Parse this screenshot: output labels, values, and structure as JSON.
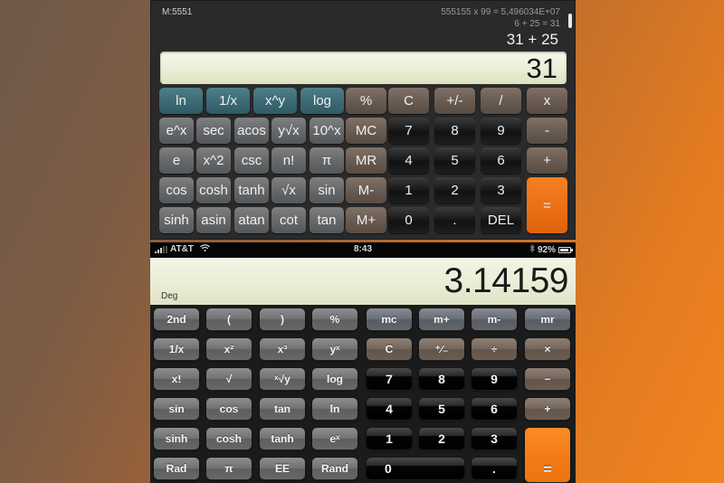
{
  "top_calculator": {
    "memory_label": "M:5551",
    "history": [
      "555155 x 99 = 5,496034E+07",
      "6 + 25 = 31"
    ],
    "current_expression": "31 + 25",
    "display_value": "31",
    "keys": [
      {
        "label": "ln",
        "style": "teal",
        "row": 0,
        "col": 0,
        "name": "key-ln"
      },
      {
        "label": "1/x",
        "style": "teal",
        "row": 0,
        "col": 1,
        "name": "key-reciprocal"
      },
      {
        "label": "x^y",
        "style": "teal",
        "row": 0,
        "col": 2,
        "name": "key-power"
      },
      {
        "label": "log",
        "style": "teal",
        "row": 0,
        "col": 3,
        "name": "key-log"
      },
      {
        "label": "%",
        "style": "brown",
        "row": 0,
        "col": 4,
        "name": "key-percent"
      },
      {
        "label": "C",
        "style": "brown",
        "row": 0,
        "col": 5,
        "name": "key-clear"
      },
      {
        "label": "+/-",
        "style": "brown",
        "row": 0,
        "col": 6,
        "name": "key-sign"
      },
      {
        "label": "/",
        "style": "brown",
        "row": 0,
        "col": 7,
        "name": "key-divide"
      },
      {
        "label": "x",
        "style": "brown",
        "row": 0,
        "col": 8,
        "name": "key-multiply"
      },
      {
        "label": "e^x",
        "style": "grey",
        "row": 1,
        "col": 0,
        "name": "key-exp"
      },
      {
        "label": "sec",
        "style": "grey",
        "row": 1,
        "col": 1,
        "name": "key-sec"
      },
      {
        "label": "acos",
        "style": "grey",
        "row": 1,
        "col": 2,
        "name": "key-acos"
      },
      {
        "label": "y√x",
        "style": "grey",
        "row": 1,
        "col": 3,
        "name": "key-yroot"
      },
      {
        "label": "10^x",
        "style": "grey",
        "row": 1,
        "col": 4,
        "name": "key-ten-power"
      },
      {
        "label": "MC",
        "style": "brown",
        "row": 1,
        "col": 5,
        "name": "key-mc"
      },
      {
        "label": "7",
        "style": "black",
        "row": 1,
        "col": 6,
        "name": "key-7"
      },
      {
        "label": "8",
        "style": "black",
        "row": 1,
        "col": 7,
        "name": "key-8"
      },
      {
        "label": "9",
        "style": "black",
        "row": 1,
        "col": 8,
        "name": "key-9"
      },
      {
        "label": "-",
        "style": "brown",
        "row": 1,
        "col": 9,
        "name": "key-minus"
      },
      {
        "label": "e",
        "style": "grey",
        "row": 2,
        "col": 0,
        "name": "key-e"
      },
      {
        "label": "x^2",
        "style": "grey",
        "row": 2,
        "col": 1,
        "name": "key-square"
      },
      {
        "label": "csc",
        "style": "grey",
        "row": 2,
        "col": 2,
        "name": "key-csc"
      },
      {
        "label": "n!",
        "style": "grey",
        "row": 2,
        "col": 3,
        "name": "key-factorial"
      },
      {
        "label": "π",
        "style": "grey",
        "row": 2,
        "col": 4,
        "name": "key-pi"
      },
      {
        "label": "MR",
        "style": "brown",
        "row": 2,
        "col": 5,
        "name": "key-mr"
      },
      {
        "label": "4",
        "style": "black",
        "row": 2,
        "col": 6,
        "name": "key-4"
      },
      {
        "label": "5",
        "style": "black",
        "row": 2,
        "col": 7,
        "name": "key-5"
      },
      {
        "label": "6",
        "style": "black",
        "row": 2,
        "col": 8,
        "name": "key-6"
      },
      {
        "label": "+",
        "style": "brown",
        "row": 2,
        "col": 9,
        "name": "key-plus"
      },
      {
        "label": "cos",
        "style": "grey",
        "row": 3,
        "col": 0,
        "name": "key-cos"
      },
      {
        "label": "cosh",
        "style": "grey",
        "row": 3,
        "col": 1,
        "name": "key-cosh"
      },
      {
        "label": "tanh",
        "style": "grey",
        "row": 3,
        "col": 2,
        "name": "key-tanh"
      },
      {
        "label": "√x",
        "style": "grey",
        "row": 3,
        "col": 3,
        "name": "key-sqrt"
      },
      {
        "label": "sin",
        "style": "grey",
        "row": 3,
        "col": 4,
        "name": "key-sin"
      },
      {
        "label": "M-",
        "style": "brown",
        "row": 3,
        "col": 5,
        "name": "key-m-minus"
      },
      {
        "label": "1",
        "style": "black",
        "row": 3,
        "col": 6,
        "name": "key-1"
      },
      {
        "label": "2",
        "style": "black",
        "row": 3,
        "col": 7,
        "name": "key-2"
      },
      {
        "label": "3",
        "style": "black",
        "row": 3,
        "col": 8,
        "name": "key-3"
      },
      {
        "label": "=",
        "style": "orange",
        "row": 3,
        "col": 9,
        "rowspan": 2,
        "name": "key-equals"
      },
      {
        "label": "sinh",
        "style": "grey",
        "row": 4,
        "col": 0,
        "name": "key-sinh"
      },
      {
        "label": "asin",
        "style": "grey",
        "row": 4,
        "col": 1,
        "name": "key-asin"
      },
      {
        "label": "atan",
        "style": "grey",
        "row": 4,
        "col": 2,
        "name": "key-atan"
      },
      {
        "label": "cot",
        "style": "grey",
        "row": 4,
        "col": 3,
        "name": "key-cot"
      },
      {
        "label": "tan",
        "style": "grey",
        "row": 4,
        "col": 4,
        "name": "key-tan"
      },
      {
        "label": "M+",
        "style": "brown",
        "row": 4,
        "col": 5,
        "name": "key-m-plus"
      },
      {
        "label": "0",
        "style": "black",
        "row": 4,
        "col": 6,
        "name": "key-0"
      },
      {
        "label": ".",
        "style": "black",
        "row": 4,
        "col": 7,
        "name": "key-decimal"
      },
      {
        "label": "DEL",
        "style": "black",
        "row": 4,
        "col": 8,
        "name": "key-delete"
      }
    ]
  },
  "bottom_calculator": {
    "status_bar": {
      "carrier": "AT&T",
      "time": "8:43",
      "battery": "92%",
      "battery_level": 0.92,
      "icons": [
        "signal-icon",
        "wifi-icon",
        "bluetooth-icon",
        "battery-icon"
      ]
    },
    "display_value": "3.14159",
    "angle_mode": "Deg",
    "keys": [
      {
        "label": "2nd",
        "style": "grey",
        "row": 0,
        "col": 0,
        "name": "key-2nd"
      },
      {
        "label": "(",
        "style": "grey",
        "row": 0,
        "col": 1,
        "name": "key-open-paren"
      },
      {
        "label": ")",
        "style": "grey",
        "row": 0,
        "col": 2,
        "name": "key-close-paren"
      },
      {
        "label": "%",
        "style": "grey",
        "row": 0,
        "col": 3,
        "name": "key-percent"
      },
      {
        "label": "mc",
        "style": "slate",
        "row": 0,
        "col": 4,
        "name": "key-mc"
      },
      {
        "label": "m+",
        "style": "slate",
        "row": 0,
        "col": 5,
        "name": "key-m-plus"
      },
      {
        "label": "m-",
        "style": "slate",
        "row": 0,
        "col": 6,
        "name": "key-m-minus"
      },
      {
        "label": "mr",
        "style": "slate",
        "row": 0,
        "col": 7,
        "name": "key-mr"
      },
      {
        "label": "1/x",
        "style": "grey",
        "row": 1,
        "col": 0,
        "name": "key-reciprocal"
      },
      {
        "label": "x²",
        "style": "grey",
        "row": 1,
        "col": 1,
        "name": "key-square"
      },
      {
        "label": "x³",
        "style": "grey",
        "row": 1,
        "col": 2,
        "name": "key-cube"
      },
      {
        "label": "yˣ",
        "style": "grey",
        "row": 1,
        "col": 3,
        "name": "key-power"
      },
      {
        "label": "C",
        "style": "brown",
        "row": 1,
        "col": 4,
        "name": "key-clear"
      },
      {
        "label": "⁺∕₋",
        "style": "brown",
        "row": 1,
        "col": 5,
        "name": "key-sign"
      },
      {
        "label": "÷",
        "style": "brown",
        "row": 1,
        "col": 6,
        "name": "key-divide"
      },
      {
        "label": "×",
        "style": "brown",
        "row": 1,
        "col": 7,
        "name": "key-multiply"
      },
      {
        "label": "x!",
        "style": "grey",
        "row": 2,
        "col": 0,
        "name": "key-factorial"
      },
      {
        "label": "√",
        "style": "grey",
        "row": 2,
        "col": 1,
        "name": "key-sqrt"
      },
      {
        "label": "ˣ√y",
        "style": "grey",
        "row": 2,
        "col": 2,
        "name": "key-xroot"
      },
      {
        "label": "log",
        "style": "grey",
        "row": 2,
        "col": 3,
        "name": "key-log"
      },
      {
        "label": "7",
        "style": "black",
        "row": 2,
        "col": 4,
        "name": "key-7"
      },
      {
        "label": "8",
        "style": "black",
        "row": 2,
        "col": 5,
        "name": "key-8"
      },
      {
        "label": "9",
        "style": "black",
        "row": 2,
        "col": 6,
        "name": "key-9"
      },
      {
        "label": "−",
        "style": "brown",
        "row": 2,
        "col": 7,
        "name": "key-minus"
      },
      {
        "label": "sin",
        "style": "grey",
        "row": 3,
        "col": 0,
        "name": "key-sin"
      },
      {
        "label": "cos",
        "style": "grey",
        "row": 3,
        "col": 1,
        "name": "key-cos"
      },
      {
        "label": "tan",
        "style": "grey",
        "row": 3,
        "col": 2,
        "name": "key-tan"
      },
      {
        "label": "ln",
        "style": "grey",
        "row": 3,
        "col": 3,
        "name": "key-ln"
      },
      {
        "label": "4",
        "style": "black",
        "row": 3,
        "col": 4,
        "name": "key-4"
      },
      {
        "label": "5",
        "style": "black",
        "row": 3,
        "col": 5,
        "name": "key-5"
      },
      {
        "label": "6",
        "style": "black",
        "row": 3,
        "col": 6,
        "name": "key-6"
      },
      {
        "label": "+",
        "style": "brown",
        "row": 3,
        "col": 7,
        "name": "key-plus"
      },
      {
        "label": "sinh",
        "style": "grey",
        "row": 4,
        "col": 0,
        "name": "key-sinh"
      },
      {
        "label": "cosh",
        "style": "grey",
        "row": 4,
        "col": 1,
        "name": "key-cosh"
      },
      {
        "label": "tanh",
        "style": "grey",
        "row": 4,
        "col": 2,
        "name": "key-tanh"
      },
      {
        "label": "eˣ",
        "style": "grey",
        "row": 4,
        "col": 3,
        "name": "key-exp"
      },
      {
        "label": "1",
        "style": "black",
        "row": 4,
        "col": 4,
        "name": "key-1"
      },
      {
        "label": "2",
        "style": "black",
        "row": 4,
        "col": 5,
        "name": "key-2"
      },
      {
        "label": "3",
        "style": "black",
        "row": 4,
        "col": 6,
        "name": "key-3"
      },
      {
        "label": "=",
        "style": "orange",
        "row": 4,
        "col": 7,
        "rowspan": 2,
        "name": "key-equals"
      },
      {
        "label": "Rad",
        "style": "grey",
        "row": 5,
        "col": 0,
        "name": "key-rad"
      },
      {
        "label": "π",
        "style": "grey",
        "row": 5,
        "col": 1,
        "name": "key-pi"
      },
      {
        "label": "EE",
        "style": "grey",
        "row": 5,
        "col": 2,
        "name": "key-ee"
      },
      {
        "label": "Rand",
        "style": "grey",
        "row": 5,
        "col": 3,
        "name": "key-rand"
      },
      {
        "label": "0",
        "style": "black",
        "row": 5,
        "col": 4,
        "colspan": 2,
        "name": "key-0"
      },
      {
        "label": ".",
        "style": "black",
        "row": 5,
        "col": 6,
        "name": "key-decimal"
      }
    ]
  }
}
